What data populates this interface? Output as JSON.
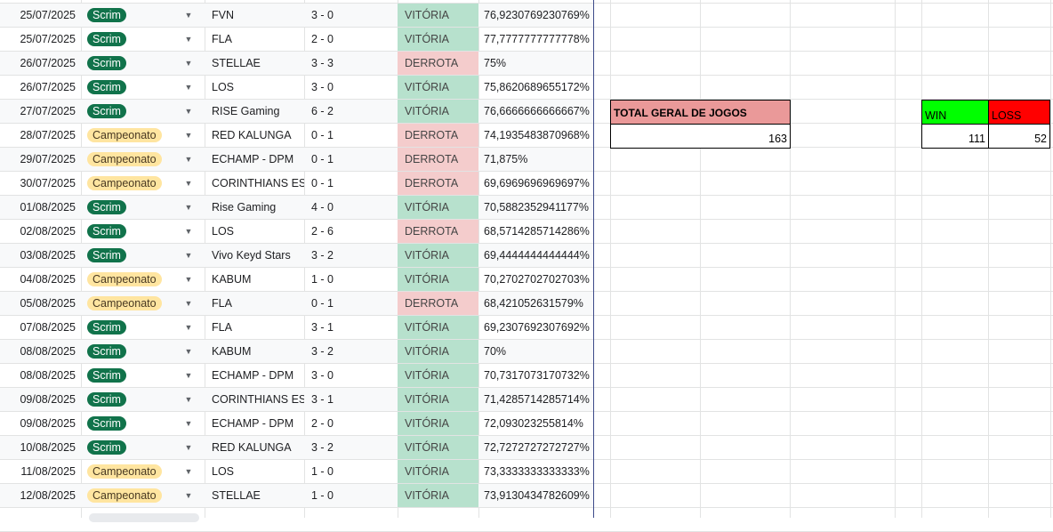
{
  "rows": [
    {
      "date": "25/07/2025",
      "type": "Scrim",
      "opponent": "FVN",
      "score": "3 - 0",
      "result": "VITÓRIA",
      "pct": "76,9230769230769%"
    },
    {
      "date": "25/07/2025",
      "type": "Scrim",
      "opponent": "FLA",
      "score": "2 - 0",
      "result": "VITÓRIA",
      "pct": "77,7777777777778%"
    },
    {
      "date": "26/07/2025",
      "type": "Scrim",
      "opponent": "STELLAE",
      "score": "3 - 3",
      "result": "DERROTA",
      "pct": "75%"
    },
    {
      "date": "26/07/2025",
      "type": "Scrim",
      "opponent": "LOS",
      "score": "3 - 0",
      "result": "VITÓRIA",
      "pct": "75,8620689655172%"
    },
    {
      "date": "27/07/2025",
      "type": "Scrim",
      "opponent": "RISE Gaming",
      "score": "6 - 2",
      "result": "VITÓRIA",
      "pct": "76,6666666666667%"
    },
    {
      "date": "28/07/2025",
      "type": "Campeonato",
      "opponent": "RED KALUNGA",
      "score": "0 - 1",
      "result": "DERROTA",
      "pct": "74,1935483870968%"
    },
    {
      "date": "29/07/2025",
      "type": "Campeonato",
      "opponent": "ECHAMP - DPM",
      "score": "0 - 1",
      "result": "DERROTA",
      "pct": "71,875%"
    },
    {
      "date": "30/07/2025",
      "type": "Campeonato",
      "opponent": "CORINTHIANS ESPORTS",
      "score": "0 - 1",
      "result": "DERROTA",
      "pct": "69,6969696969697%"
    },
    {
      "date": "01/08/2025",
      "type": "Scrim",
      "opponent": "Rise Gaming",
      "score": "4 - 0",
      "result": "VITÓRIA",
      "pct": "70,5882352941177%"
    },
    {
      "date": "02/08/2025",
      "type": "Scrim",
      "opponent": "LOS",
      "score": "2 - 6",
      "result": "DERROTA",
      "pct": "68,5714285714286%"
    },
    {
      "date": "03/08/2025",
      "type": "Scrim",
      "opponent": "Vivo Keyd Stars",
      "score": "3 - 2",
      "result": "VITÓRIA",
      "pct": "69,4444444444444%"
    },
    {
      "date": "04/08/2025",
      "type": "Campeonato",
      "opponent": "KABUM",
      "score": "1 - 0",
      "result": "VITÓRIA",
      "pct": "70,2702702702703%"
    },
    {
      "date": "05/08/2025",
      "type": "Campeonato",
      "opponent": "FLA",
      "score": "0 - 1",
      "result": "DERROTA",
      "pct": "68,421052631579%"
    },
    {
      "date": "07/08/2025",
      "type": "Scrim",
      "opponent": "FLA",
      "score": "3 - 1",
      "result": "VITÓRIA",
      "pct": "69,2307692307692%"
    },
    {
      "date": "08/08/2025",
      "type": "Scrim",
      "opponent": "KABUM",
      "score": "3 - 2",
      "result": "VITÓRIA",
      "pct": "70%"
    },
    {
      "date": "08/08/2025",
      "type": "Scrim",
      "opponent": "ECHAMP - DPM",
      "score": "3 - 0",
      "result": "VITÓRIA",
      "pct": "70,7317073170732%"
    },
    {
      "date": "09/08/2025",
      "type": "Scrim",
      "opponent": "CORINTHIANS ESPORTS",
      "score": "3 - 1",
      "result": "VITÓRIA",
      "pct": "71,4285714285714%"
    },
    {
      "date": "09/08/2025",
      "type": "Scrim",
      "opponent": "ECHAMP - DPM",
      "score": "2 - 0",
      "result": "VITÓRIA",
      "pct": "72,093023255814%"
    },
    {
      "date": "10/08/2025",
      "type": "Scrim",
      "opponent": "RED KALUNGA",
      "score": "3 - 2",
      "result": "VITÓRIA",
      "pct": "72,7272727272727%"
    },
    {
      "date": "11/08/2025",
      "type": "Campeonato",
      "opponent": "LOS",
      "score": "1 - 0",
      "result": "VITÓRIA",
      "pct": "73,3333333333333%"
    },
    {
      "date": "12/08/2025",
      "type": "Campeonato",
      "opponent": "STELLAE",
      "score": "1 - 0",
      "result": "VITÓRIA",
      "pct": "73,9130434782609%"
    }
  ],
  "summary": {
    "total_label": "TOTAL GERAL DE JOGOS",
    "total_value": "163",
    "win_label": "WIN",
    "win_value": "111",
    "loss_label": "LOSS",
    "loss_value": "52"
  },
  "colors": {
    "win_cell": "#b7e1cd",
    "loss_cell": "#f4cccc",
    "scrim_chip": "#11734b",
    "campeonato_chip": "#ffe5a0",
    "total_header": "#ea9999",
    "win_header": "#00ff00",
    "loss_header": "#ff0000"
  }
}
